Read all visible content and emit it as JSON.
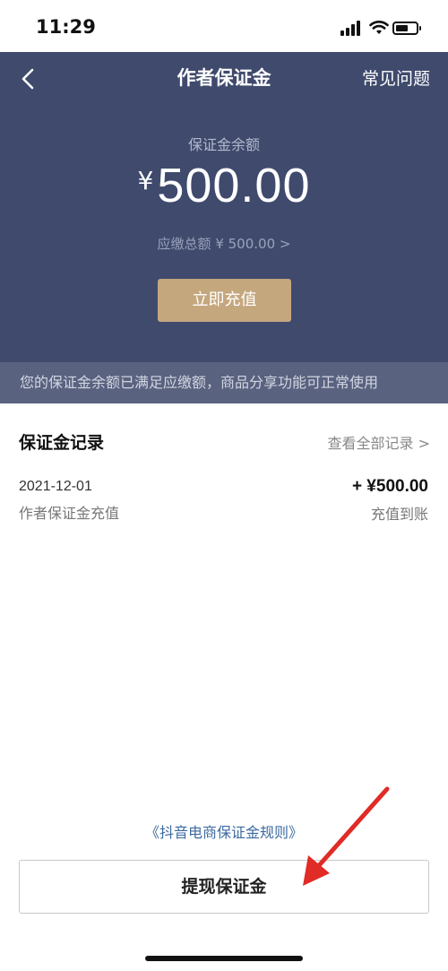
{
  "status_bar": {
    "time": "11:29"
  },
  "header": {
    "title": "作者保证金",
    "faq": "常见问题",
    "balance_label": "保证金余额",
    "currency": "¥",
    "balance": "500.00",
    "payable": "应缴总额 ¥ 500.00 >",
    "recharge_button": "立即充值",
    "notice": "您的保证金余额已满足应缴额，商品分享功能可正常使用"
  },
  "records": {
    "title": "保证金记录",
    "view_all": "查看全部记录 >",
    "items": [
      {
        "date": "2021-12-01",
        "description": "作者保证金充值",
        "amount": "+ ¥500.00",
        "status": "充值到账"
      }
    ]
  },
  "footer": {
    "rules_link": "《抖音电商保证金规则》",
    "withdraw_button": "提现保证金"
  },
  "colors": {
    "header_bg": "#3f4a6d",
    "notice_bg": "#59627f",
    "accent_gold": "#c5a77e",
    "link_blue": "#3c6aa0",
    "annotation_red": "#e02b27"
  },
  "icons": [
    "back-chevron-icon",
    "signal-icon",
    "wifi-icon",
    "battery-icon"
  ]
}
